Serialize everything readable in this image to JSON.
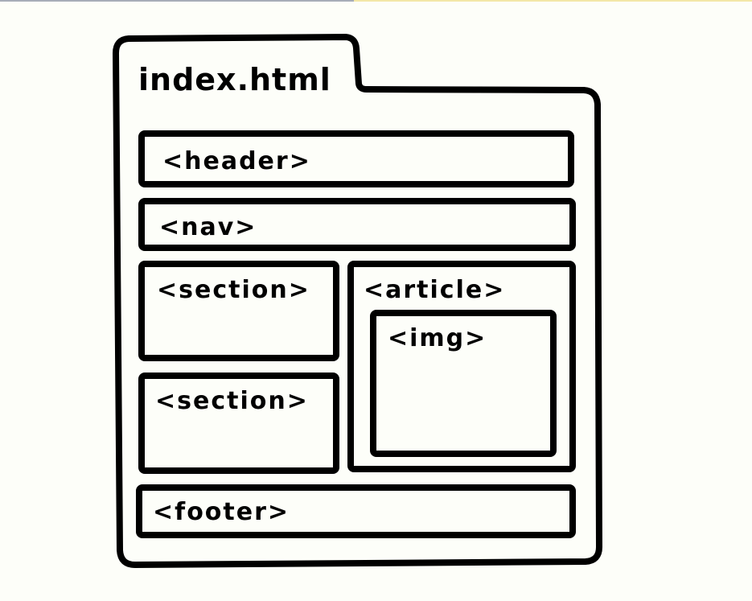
{
  "diagram": {
    "file_tab": "index.html",
    "elements": {
      "header": "<header>",
      "nav": "<nav>",
      "section_1": "<section>",
      "section_2": "<section>",
      "article": "<article>",
      "img": "<img>",
      "footer": "<footer>"
    }
  }
}
